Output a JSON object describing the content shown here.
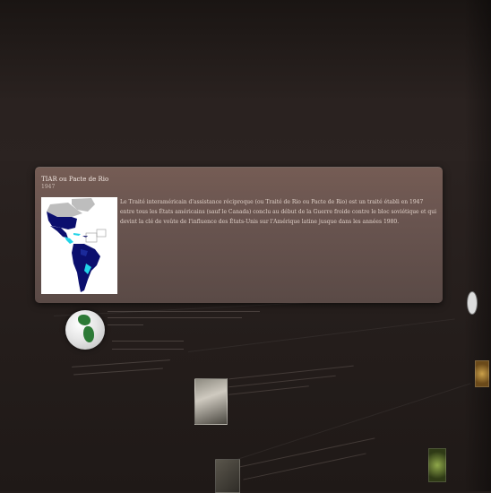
{
  "tooltip": {
    "title": "TIAR ou Pacte de Rio",
    "year": "1947",
    "description": "Le Traité interaméricain d'assistance réciproque (ou Traité de Rio ou Pacte de Rio) est un traité établi en 1947 entre tous les États américains (sauf le Canada) conclu au début de la Guerre froide contre le bloc soviétique et qui devint la clé de voûte de l'influence des États-Unis sur l'Amérique latine jusque dans les années 1980."
  },
  "colors": {
    "background": "#231c1a",
    "card": "#6a5550",
    "map_member_dark": "#0b0f6e",
    "map_member_light": "#22d4e8",
    "map_other": "#bdbdbd"
  }
}
